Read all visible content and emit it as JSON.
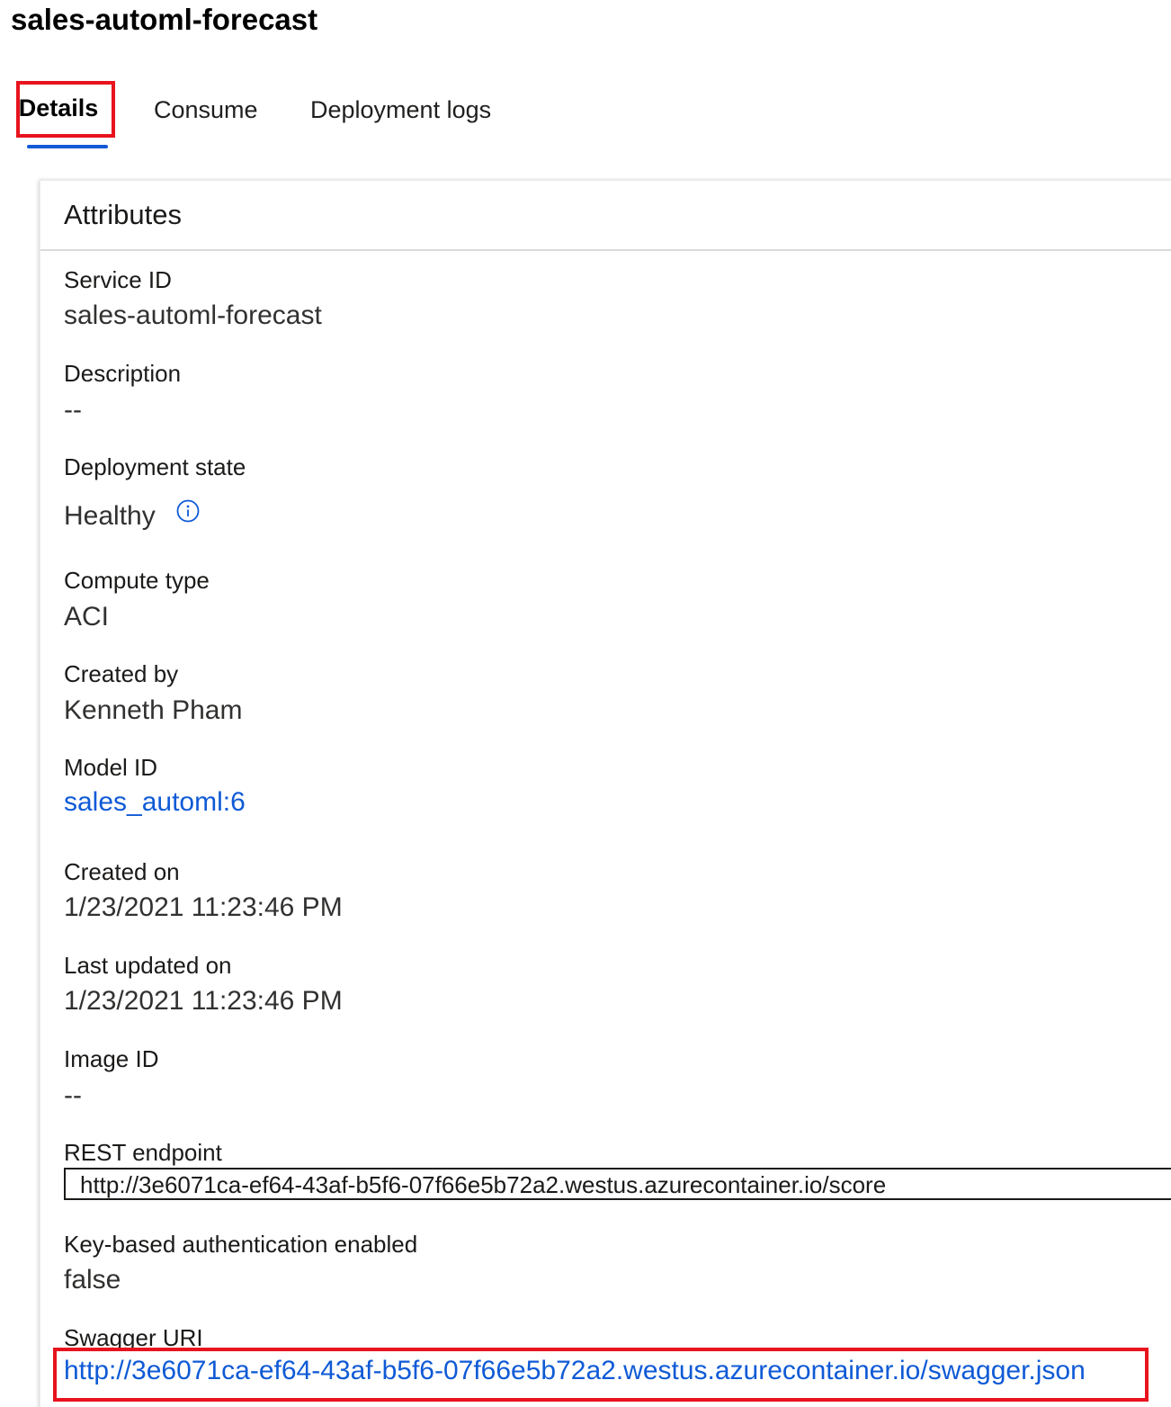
{
  "page": {
    "title": "sales-automl-forecast"
  },
  "tabs": [
    {
      "label": "Details",
      "selected": true
    },
    {
      "label": "Consume",
      "selected": false
    },
    {
      "label": "Deployment logs",
      "selected": false
    }
  ],
  "card": {
    "title": "Attributes",
    "fields": {
      "service_id": {
        "label": "Service ID",
        "value": "sales-automl-forecast"
      },
      "description": {
        "label": "Description",
        "value": "--"
      },
      "deployment_state": {
        "label": "Deployment state",
        "value": "Healthy",
        "icon": "info-icon"
      },
      "compute_type": {
        "label": "Compute type",
        "value": "ACI"
      },
      "created_by": {
        "label": "Created by",
        "value": "Kenneth Pham"
      },
      "model_id": {
        "label": "Model ID",
        "value": "sales_automl:6"
      },
      "created_on": {
        "label": "Created on",
        "value": "1/23/2021 11:23:46 PM"
      },
      "last_updated_on": {
        "label": "Last updated on",
        "value": "1/23/2021 11:23:46 PM"
      },
      "image_id": {
        "label": "Image ID",
        "value": "--"
      },
      "rest_endpoint": {
        "label": "REST endpoint",
        "value": "http://3e6071ca-ef64-43af-b5f6-07f66e5b72a2.westus.azurecontainer.io/score"
      },
      "key_auth": {
        "label": "Key-based authentication enabled",
        "value": "false"
      },
      "swagger_uri": {
        "label": "Swagger URI",
        "value": "http://3e6071ca-ef64-43af-b5f6-07f66e5b72a2.westus.azurecontainer.io/swagger.json"
      }
    }
  },
  "colors": {
    "accent": "#0f5ad6",
    "highlight": "#e8131d"
  }
}
